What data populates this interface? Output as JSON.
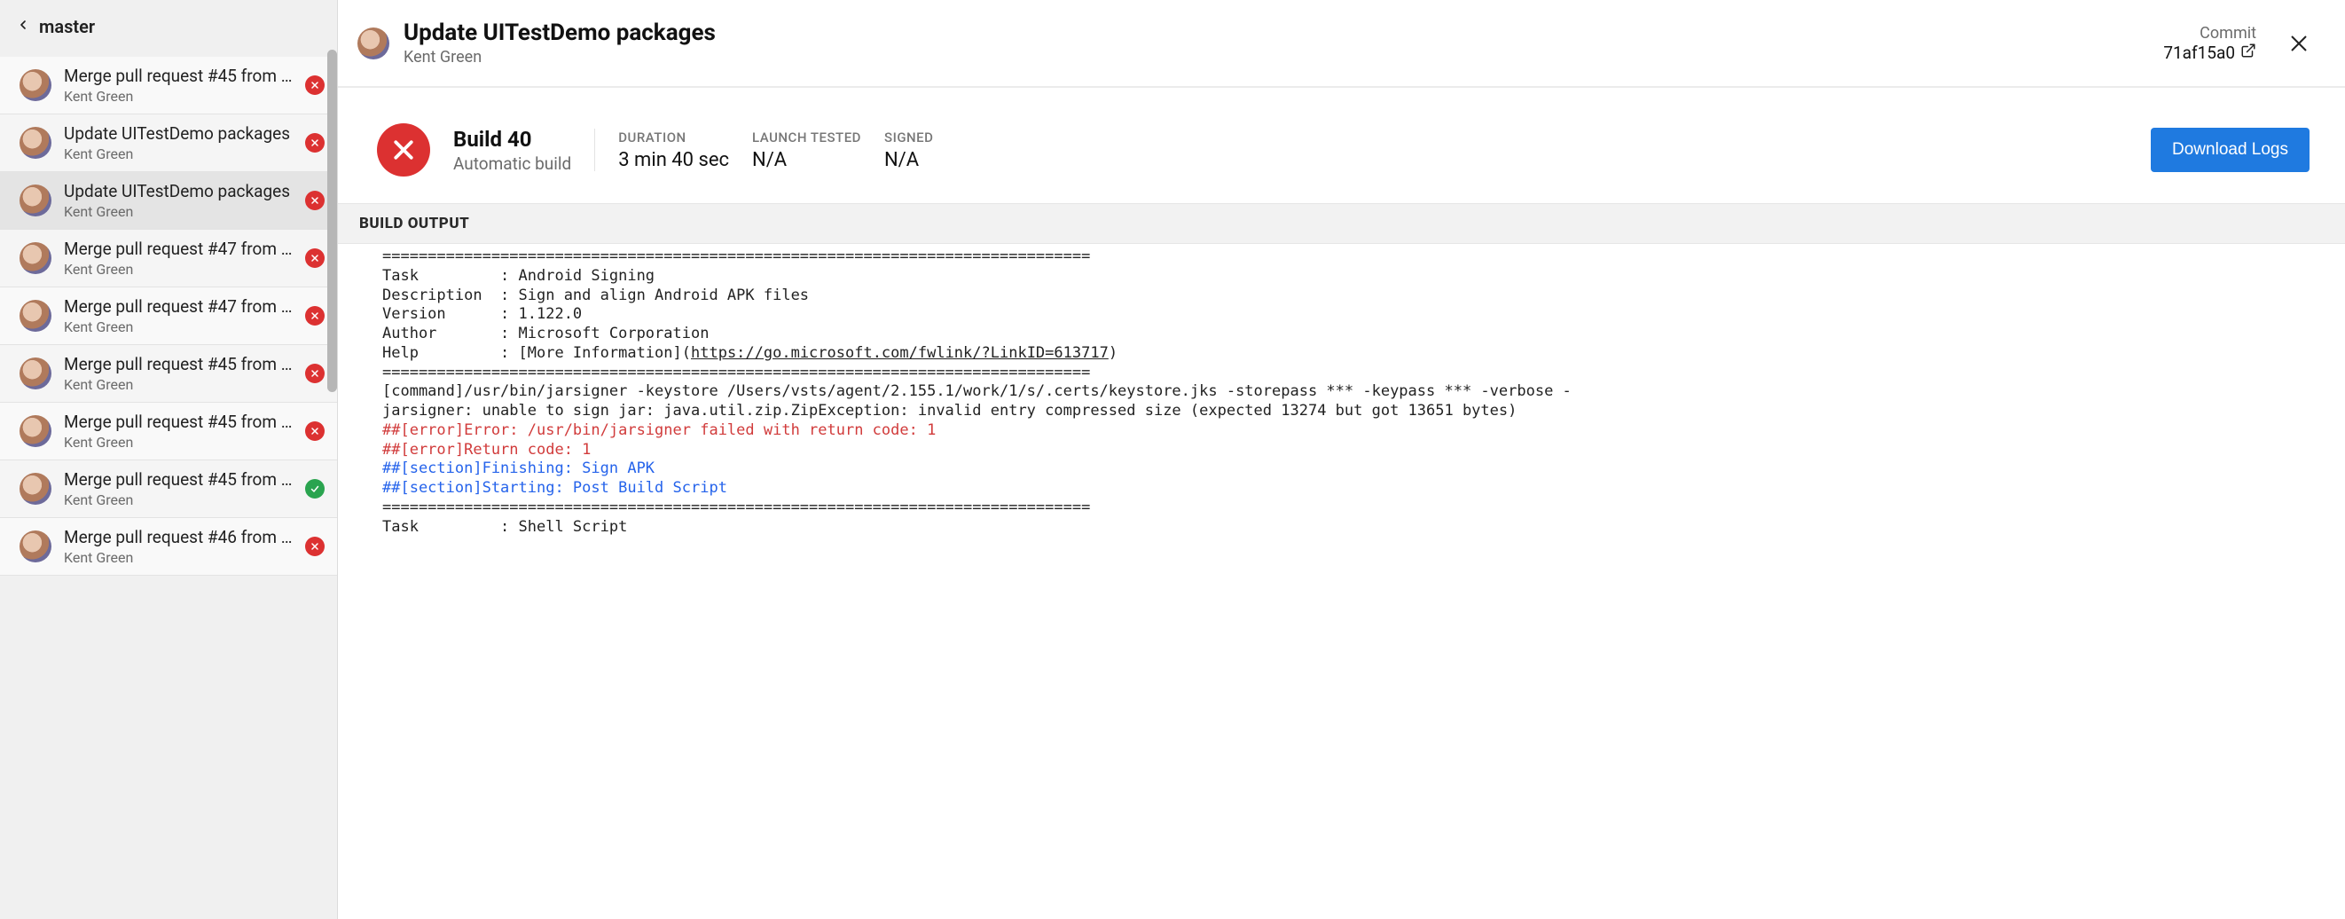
{
  "sidebar": {
    "branch": "master",
    "commits": [
      {
        "title": "Merge pull request #45 from Kin…",
        "author": "Kent Green",
        "status": "fail"
      },
      {
        "title": "Update UITestDemo packages",
        "author": "Kent Green",
        "status": "fail"
      },
      {
        "title": "Update UITestDemo packages",
        "author": "Kent Green",
        "status": "fail",
        "selected": true
      },
      {
        "title": "Merge pull request #47 from Kin…",
        "author": "Kent Green",
        "status": "fail"
      },
      {
        "title": "Merge pull request #47 from Kin…",
        "author": "Kent Green",
        "status": "fail"
      },
      {
        "title": "Merge pull request #45 from Kin…",
        "author": "Kent Green",
        "status": "fail"
      },
      {
        "title": "Merge pull request #45 from Kin…",
        "author": "Kent Green",
        "status": "fail"
      },
      {
        "title": "Merge pull request #45 from Kin…",
        "author": "Kent Green",
        "status": "pass"
      },
      {
        "title": "Merge pull request #46 from Kin…",
        "author": "Kent Green",
        "status": "fail"
      }
    ]
  },
  "detail": {
    "title": "Update UITestDemo packages",
    "author": "Kent Green",
    "commit_label": "Commit",
    "commit_hash": "71af15a0",
    "build_title": "Build 40",
    "build_subtitle": "Automatic build",
    "stats": {
      "duration_label": "DURATION",
      "duration_value": "3 min 40 sec",
      "launch_label": "LAUNCH TESTED",
      "launch_value": "N/A",
      "signed_label": "SIGNED",
      "signed_value": "N/A"
    },
    "download_label": "Download Logs",
    "output_header": "BUILD OUTPUT",
    "log": {
      "divider": "==============================================================================",
      "task_line": "Task         : Android Signing",
      "desc_line": "Description  : Sign and align Android APK files",
      "version_line": "Version      : 1.122.0",
      "author_line": "Author       : Microsoft Corporation",
      "help_prefix": "Help         : [More Information](",
      "help_url": "https://go.microsoft.com/fwlink/?LinkID=613717",
      "help_suffix": ")",
      "cmd_line": "[command]/usr/bin/jarsigner -keystore /Users/vsts/agent/2.155.1/work/1/s/.certs/keystore.jks -storepass *** -keypass *** -verbose -",
      "jar_err_line": "jarsigner: unable to sign jar: java.util.zip.ZipException: invalid entry compressed size (expected 13274 but got 13651 bytes)",
      "err1": "##[error]Error: /usr/bin/jarsigner failed with return code: 1",
      "err2": "##[error]Return code: 1",
      "sect_finish": "##[section]Finishing: Sign APK",
      "sect_start": "##[section]Starting: Post Build Script",
      "task2_line": "Task         : Shell Script"
    }
  }
}
